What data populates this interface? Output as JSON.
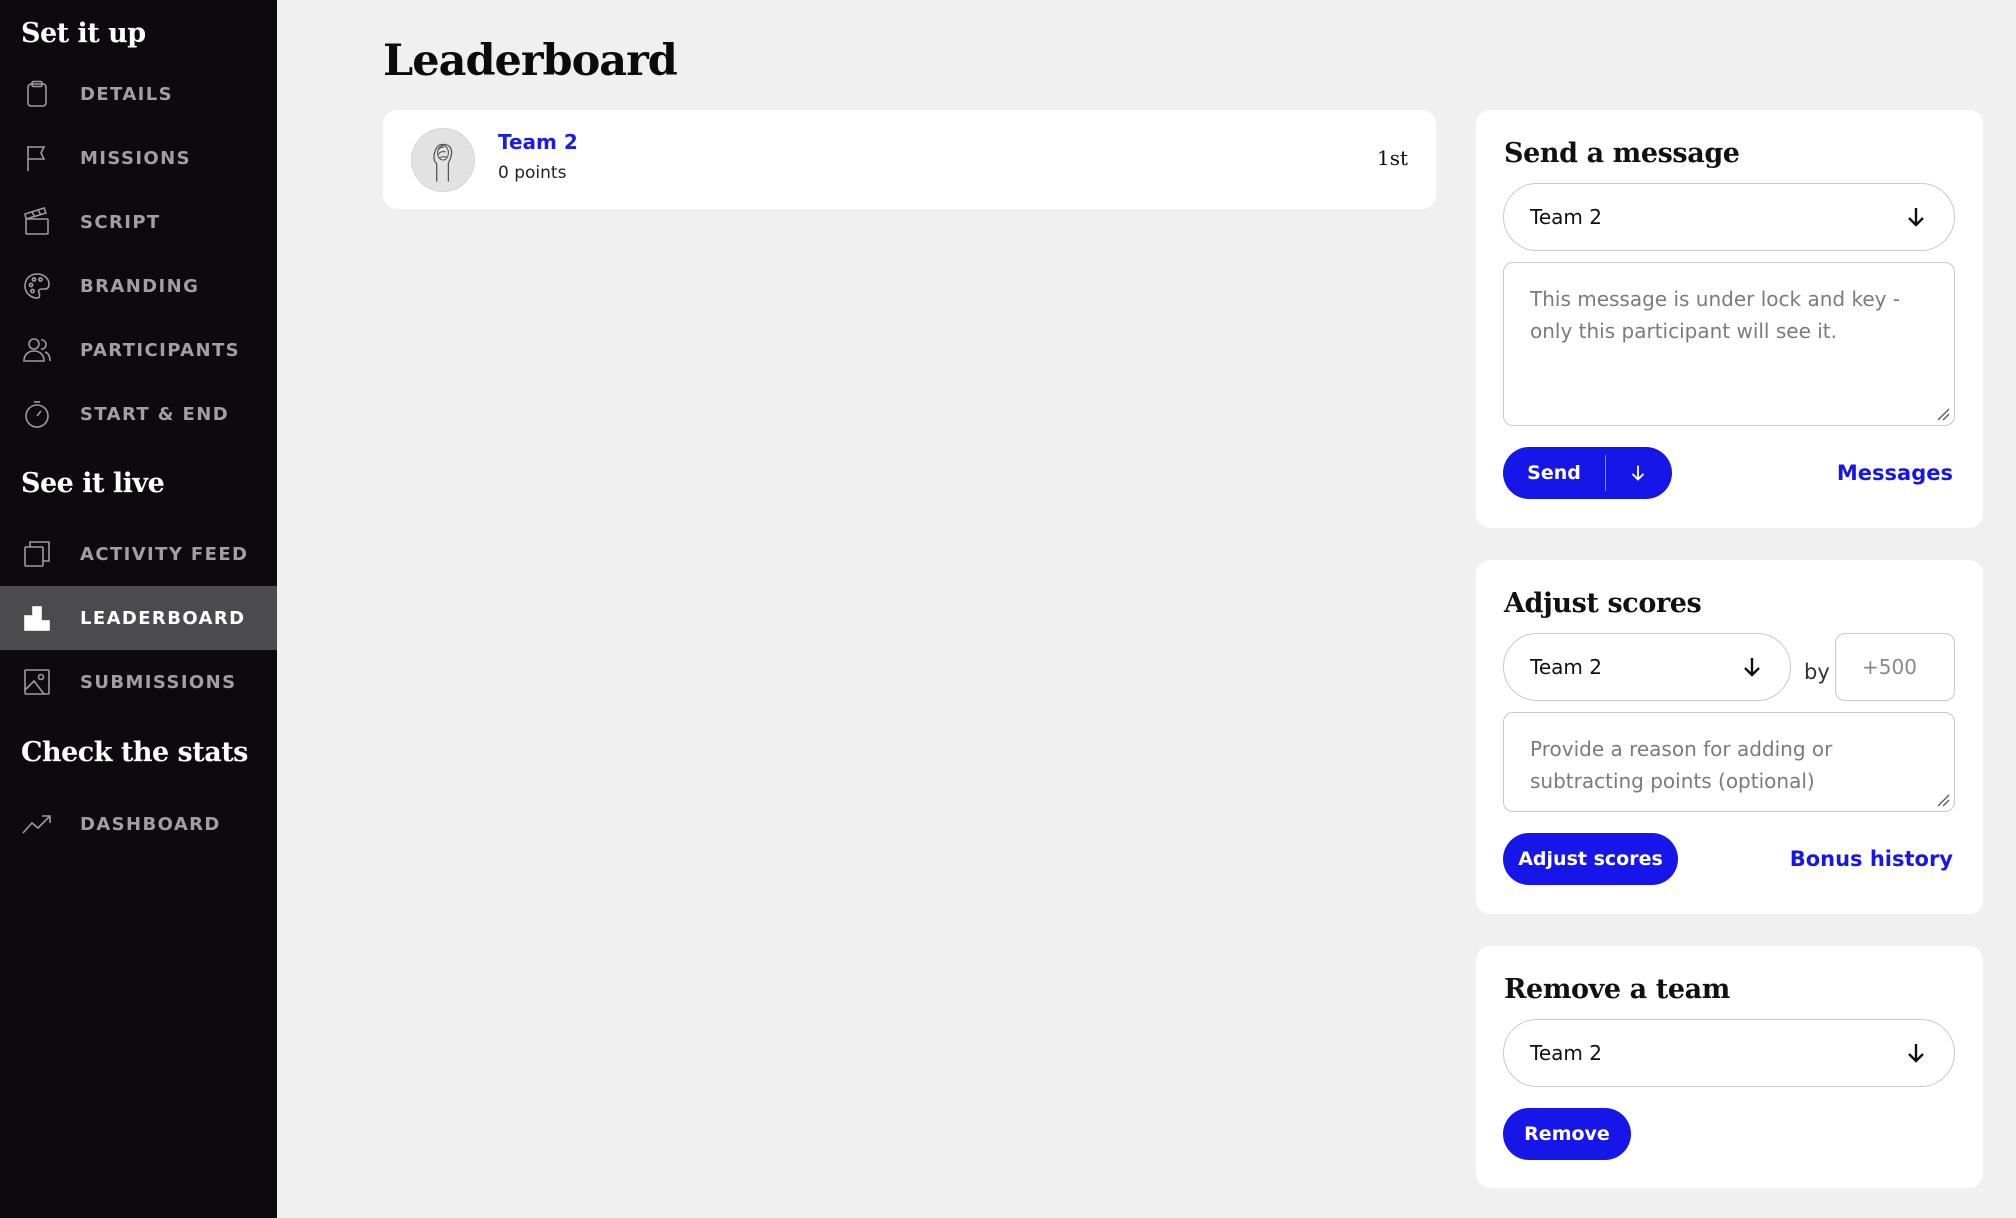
{
  "sidebar": {
    "sections": [
      {
        "heading": "Set it up",
        "items": [
          {
            "label": "DETAILS",
            "icon": "clipboard-icon"
          },
          {
            "label": "MISSIONS",
            "icon": "flag-icon"
          },
          {
            "label": "SCRIPT",
            "icon": "clapperboard-icon"
          },
          {
            "label": "BRANDING",
            "icon": "palette-icon"
          },
          {
            "label": "PARTICIPANTS",
            "icon": "users-icon"
          },
          {
            "label": "START & END",
            "icon": "stopwatch-icon"
          }
        ]
      },
      {
        "heading": "See it live",
        "items": [
          {
            "label": "ACTIVITY FEED",
            "icon": "feed-icon"
          },
          {
            "label": "LEADERBOARD",
            "icon": "podium-icon",
            "active": true
          },
          {
            "label": "SUBMISSIONS",
            "icon": "image-icon"
          }
        ]
      },
      {
        "heading": "Check the stats",
        "items": [
          {
            "label": "DASHBOARD",
            "icon": "trend-icon"
          }
        ]
      }
    ]
  },
  "main": {
    "title": "Leaderboard",
    "leaderboard": [
      {
        "name": "Team 2",
        "points": "0 points",
        "rank": "1st",
        "avatar": "raised-fist-icon"
      }
    ]
  },
  "send_message": {
    "title": "Send a message",
    "team_select": "Team 2",
    "message_placeholder": "This message is under lock and key - only this participant will see it.",
    "send_label": "Send",
    "messages_link": "Messages"
  },
  "adjust_scores": {
    "title": "Adjust scores",
    "team_select": "Team 2",
    "by_label": "by",
    "points_placeholder": "+500",
    "reason_placeholder": "Provide a reason for adding or subtracting points (optional)",
    "adjust_label": "Adjust scores",
    "bonus_link": "Bonus history"
  },
  "remove_team": {
    "title": "Remove a team",
    "team_select": "Team 2",
    "remove_label": "Remove"
  },
  "colors": {
    "accent": "#1616e8",
    "sidebar_bg": "#0c0a0c",
    "active_item_bg": "#4b4a4c",
    "page_bg": "#f1f0f0"
  }
}
